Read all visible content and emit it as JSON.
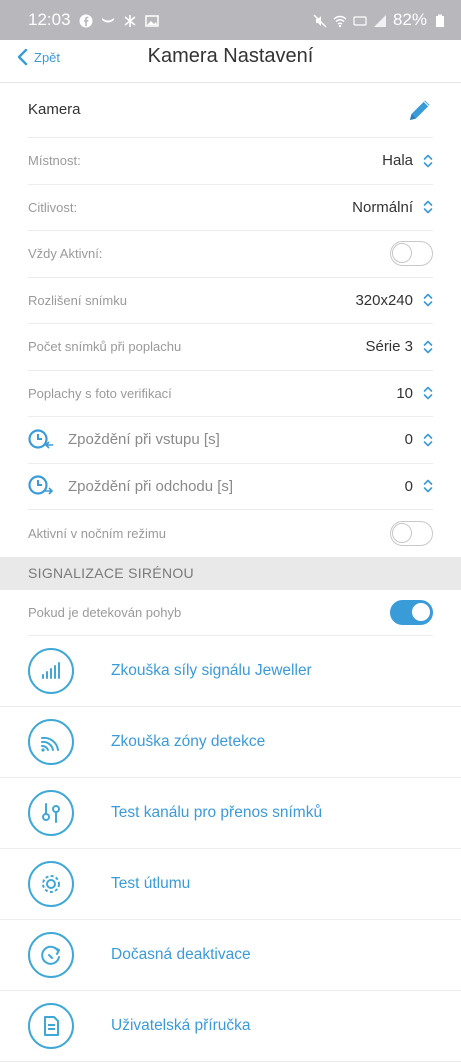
{
  "status_bar": {
    "time": "12:03",
    "battery": "82%",
    "left_icons": [
      "facebook-icon",
      "mail-icon",
      "bluetooth-icon",
      "image-icon"
    ],
    "right_icons": [
      "mute-icon",
      "wifi-icon",
      "volte-icon",
      "signal-icon",
      "battery-icon"
    ]
  },
  "nav": {
    "back_label": "Zpět",
    "title": "Kamera Nastavení"
  },
  "settings": {
    "name_label": "Kamera",
    "room_label": "Místnost:",
    "room_value": "Hala",
    "sensitivity_label": "Citlivost:",
    "sensitivity_value": "Normální",
    "always_active_label": "Vždy Aktivní:",
    "always_active_on": false,
    "resolution_label": "Rozlišení snímku",
    "resolution_value": "320x240",
    "photos_label": "Počet snímků při poplachu",
    "photos_value": "Série 3",
    "photo_alarms_label": "Poplachy s foto verifikací",
    "photo_alarms_value": "10",
    "entry_delay_label": "Zpoždění při vstupu [s]",
    "entry_delay_value": "0",
    "exit_delay_label": "Zpoždění při odchodu [s]",
    "exit_delay_value": "0",
    "night_mode_label": "Aktivní v nočním režimu",
    "night_mode_on": false
  },
  "siren": {
    "header": "SIGNALIZACE SIRÉNOU",
    "motion_label": "Pokud je detekován pohyb",
    "motion_on": true
  },
  "actions": [
    {
      "label": "Zkouška síly signálu Jeweller",
      "icon": "signal-strength-icon"
    },
    {
      "label": "Zkouška zóny detekce",
      "icon": "detection-zone-icon"
    },
    {
      "label": "Test kanálu pro přenos snímků",
      "icon": "channel-test-icon"
    },
    {
      "label": "Test útlumu",
      "icon": "attenuation-icon"
    },
    {
      "label": "Dočasná deaktivace",
      "icon": "deactivate-icon"
    },
    {
      "label": "Uživatelská příručka",
      "icon": "manual-icon"
    }
  ],
  "colors": {
    "accent": "#3a9bd9",
    "status_bar": "#b7b7bc",
    "section_bg": "#e9e9e9"
  }
}
